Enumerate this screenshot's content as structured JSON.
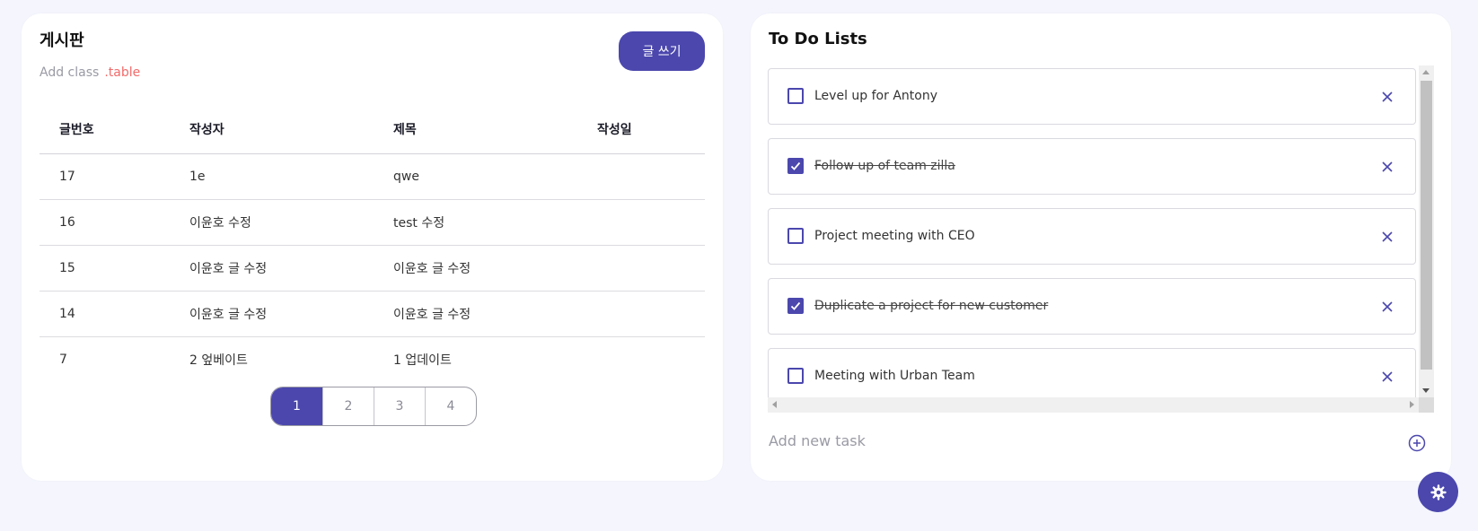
{
  "board": {
    "title": "게시판",
    "subtitle_prefix": "Add class",
    "subtitle_class": ".table",
    "write_button": "글 쓰기",
    "columns": [
      "글번호",
      "작성자",
      "제목",
      "작성일"
    ],
    "rows": [
      {
        "no": "17",
        "author": "1e",
        "title": "qwe",
        "date": ""
      },
      {
        "no": "16",
        "author": "이윤호 수정",
        "title": "test 수정",
        "date": ""
      },
      {
        "no": "15",
        "author": "이윤호 글 수정",
        "title": "이윤호 글 수정",
        "date": ""
      },
      {
        "no": "14",
        "author": "이윤호 글 수정",
        "title": "이윤호 글 수정",
        "date": ""
      },
      {
        "no": "7",
        "author": "2 엎베이트",
        "title": "1 업데이트",
        "date": ""
      }
    ],
    "pages": [
      "1",
      "2",
      "3",
      "4"
    ],
    "active_page": "1"
  },
  "todo": {
    "title": "To Do Lists",
    "items": [
      {
        "text": "Level up for Antony",
        "done": false
      },
      {
        "text": "Follow up of team zilla",
        "done": true
      },
      {
        "text": "Project meeting with CEO",
        "done": false
      },
      {
        "text": "Duplicate a project for new customer",
        "done": true
      },
      {
        "text": "Meeting with Urban Team",
        "done": false
      }
    ],
    "add_placeholder": "Add new task",
    "add_icon": "plus-circle-icon",
    "delete_icon": "close-icon"
  },
  "fab": {
    "icon": "gear-icon"
  },
  "colors": {
    "accent": "#4b47ad",
    "subtitle_class": "#f26b6b",
    "background": "#f4f5fd"
  }
}
